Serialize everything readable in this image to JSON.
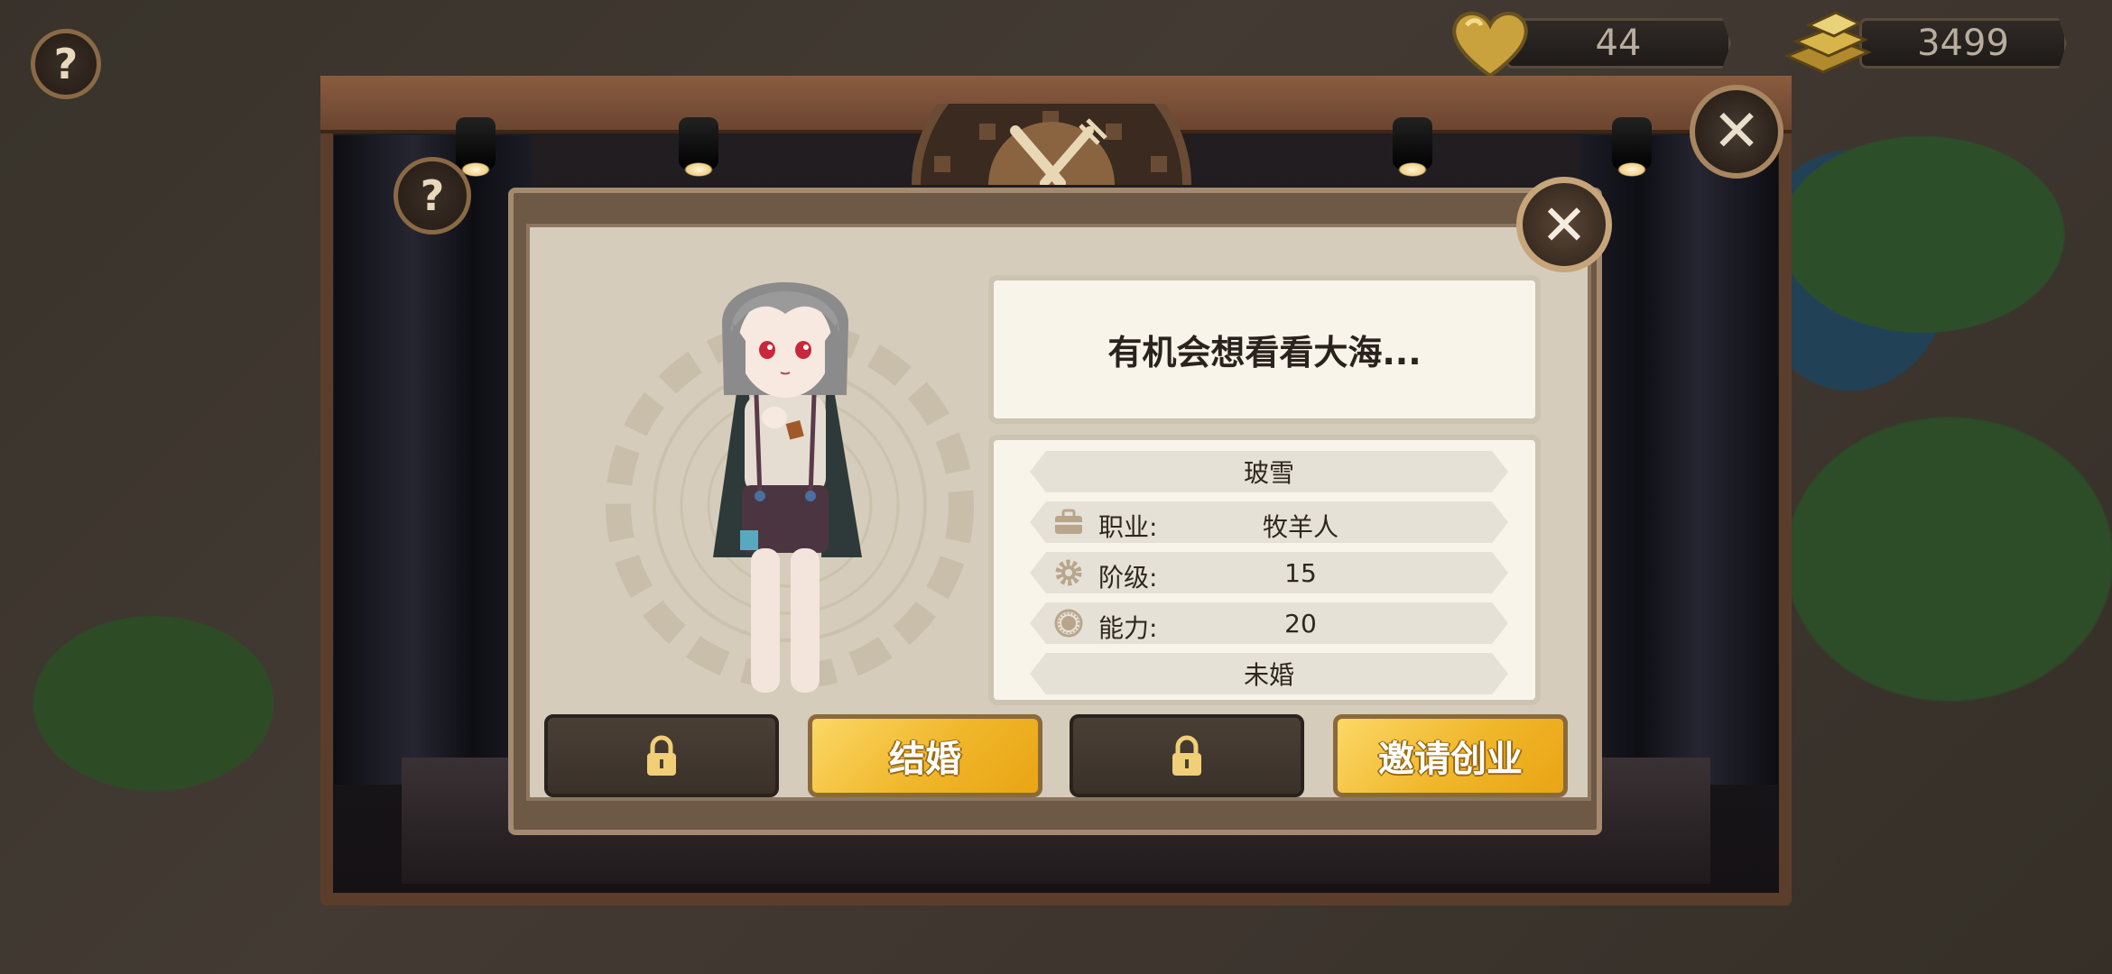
{
  "hud": {
    "help_label": "?",
    "hearts": "44",
    "gold": "3499"
  },
  "stage": {
    "help_label": "?",
    "close_label": "✕"
  },
  "dialog": {
    "close_label": "✕",
    "quote": "有机会想看看大海...",
    "name": "玻雪",
    "job_label": "职业:",
    "job_value": "牧羊人",
    "rank_label": "阶级:",
    "rank_value": "15",
    "ability_label": "能力:",
    "ability_value": "20",
    "marital_status": "未婚",
    "buttons": {
      "marry": "结婚",
      "invite": "邀请创业"
    }
  },
  "colors": {
    "gold_button": "#f0b62a",
    "locked_button": "#4a3f35",
    "panel_bg": "#d6ccbb"
  }
}
